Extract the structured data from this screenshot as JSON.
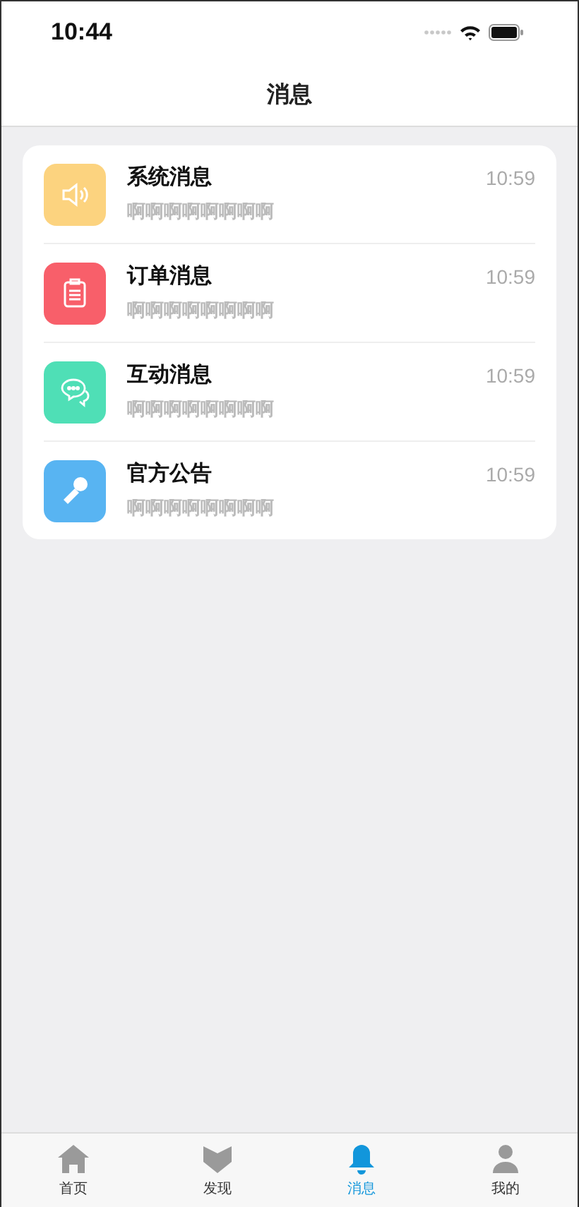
{
  "status_bar": {
    "time": "10:44"
  },
  "header": {
    "title": "消息"
  },
  "messages": [
    {
      "kind": "speaker",
      "color": "#fcd37f",
      "title": "系统消息",
      "time": "10:59",
      "preview": "啊啊啊啊啊啊啊啊"
    },
    {
      "kind": "clipboard",
      "color": "#f85f6a",
      "title": "订单消息",
      "time": "10:59",
      "preview": "啊啊啊啊啊啊啊啊"
    },
    {
      "kind": "chat",
      "color": "#4fdfb6",
      "title": "互动消息",
      "time": "10:59",
      "preview": "啊啊啊啊啊啊啊啊"
    },
    {
      "kind": "microphone",
      "color": "#58b4f2",
      "title": "官方公告",
      "time": "10:59",
      "preview": "啊啊啊啊啊啊啊啊"
    }
  ],
  "tab_bar": [
    {
      "kind": "home",
      "label": "首页",
      "selected": false
    },
    {
      "kind": "discover",
      "label": "发现",
      "selected": false
    },
    {
      "kind": "bell",
      "label": "消息",
      "selected": true
    },
    {
      "kind": "person",
      "label": "我的",
      "selected": false
    }
  ]
}
